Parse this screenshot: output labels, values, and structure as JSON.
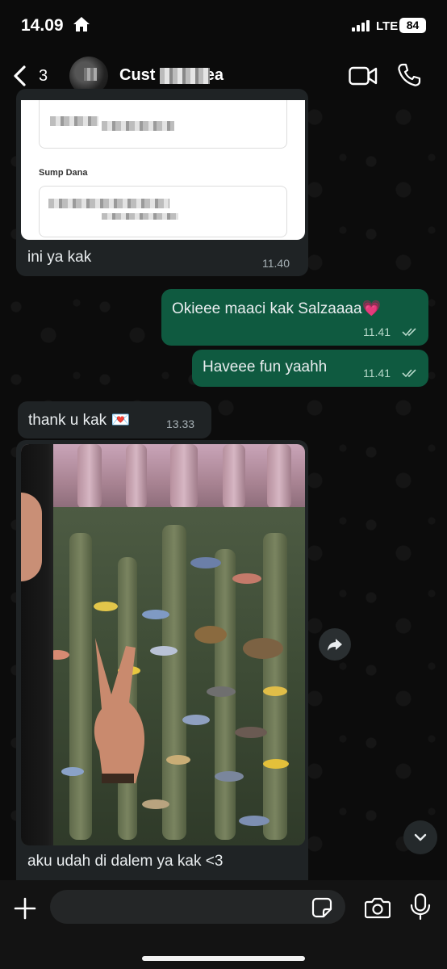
{
  "status_bar": {
    "time": "14.09",
    "network": "LTE",
    "battery": "84"
  },
  "header": {
    "back_count": "3",
    "contact_name": "Cust Salza    ea"
  },
  "document_preview": {
    "field_label": "Sump    Dana"
  },
  "messages": [
    {
      "direction": "incoming",
      "text": "ini ya kak",
      "time": "11.40"
    },
    {
      "direction": "outgoing",
      "text": "Okieee maaci kak Salzaaaa💗",
      "time": "11.41",
      "status": "read"
    },
    {
      "direction": "outgoing",
      "text": "Haveee fun yaahh",
      "time": "11.41",
      "status": "read"
    },
    {
      "direction": "incoming",
      "text": "thank u kak 💌",
      "time": "13.33"
    },
    {
      "direction": "incoming",
      "type": "photo",
      "caption": "aku udah di dalem ya kak <3"
    }
  ],
  "composer": {
    "placeholder": ""
  },
  "colors": {
    "incoming_bubble": "#1f2325",
    "outgoing_bubble": "#0f5a40",
    "background": "#0b0b0b"
  }
}
